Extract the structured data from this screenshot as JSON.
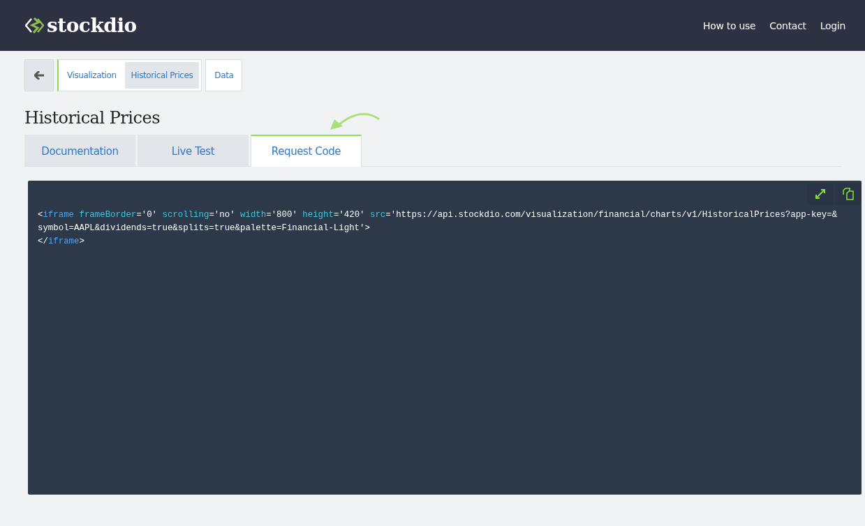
{
  "header": {
    "logo": "stockdio",
    "nav": [
      "How to use",
      "Contact",
      "Login"
    ]
  },
  "breadcrumbs": {
    "group": [
      {
        "label": "Visualization",
        "selected": false
      },
      {
        "label": "Historical Prices",
        "selected": true
      }
    ],
    "extra": [
      {
        "label": "Data",
        "selected": false
      }
    ]
  },
  "page_title": "Historical Prices",
  "tabs": [
    {
      "label": "Documentation",
      "selected": false
    },
    {
      "label": "Live Test",
      "selected": false
    },
    {
      "label": "Request Code",
      "selected": true
    }
  ],
  "code": {
    "lines": [
      [
        {
          "kind": "plain",
          "text": "<"
        },
        {
          "kind": "tag",
          "text": "iframe"
        },
        {
          "kind": "attr",
          "text": " frameBorder"
        },
        {
          "kind": "plain",
          "text": "='0' "
        },
        {
          "kind": "attr",
          "text": "scrolling"
        },
        {
          "kind": "plain",
          "text": "='no' "
        },
        {
          "kind": "attr",
          "text": "width"
        },
        {
          "kind": "plain",
          "text": "='800' "
        },
        {
          "kind": "attr",
          "text": "height"
        },
        {
          "kind": "plain",
          "text": "='420' "
        },
        {
          "kind": "attr",
          "text": "src"
        },
        {
          "kind": "plain",
          "text": "='https://api.stockdio.com/visualization/financial/charts/v1/HistoricalPrices?app-key=&"
        }
      ],
      [
        {
          "kind": "plain",
          "text": "symbol=AAPL&dividends=true&splits=true&palette=Financial-Light'>"
        }
      ],
      [
        {
          "kind": "plain",
          "text": "</"
        },
        {
          "kind": "tag",
          "text": "iframe"
        },
        {
          "kind": "plain",
          "text": ">"
        }
      ]
    ]
  }
}
